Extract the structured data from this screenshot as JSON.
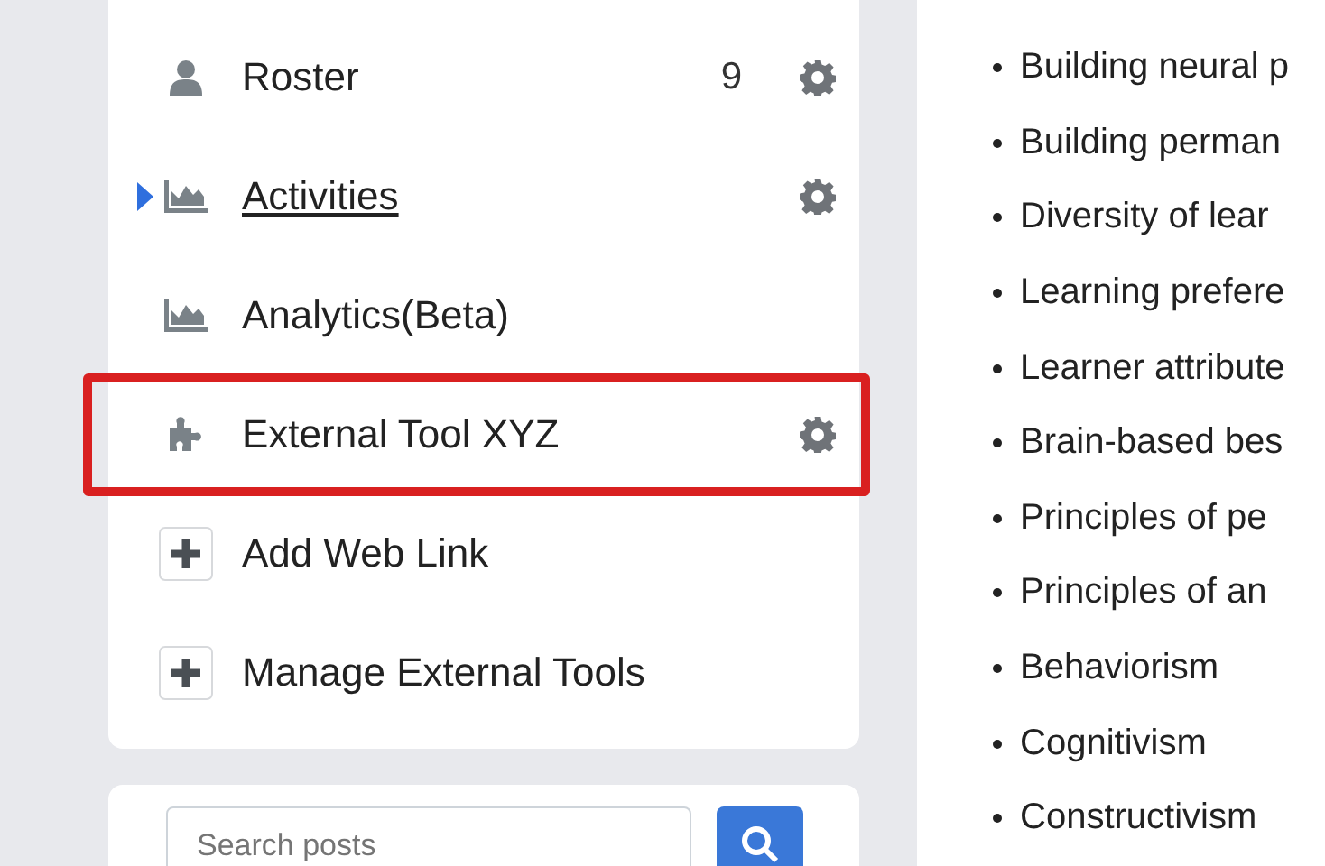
{
  "nav": {
    "items": [
      {
        "label": "Roster",
        "kind": "person",
        "count": "9",
        "selected": false,
        "highlighted": false,
        "settings": true
      },
      {
        "label": "Activities",
        "kind": "chart",
        "selected": true,
        "highlighted": false,
        "settings": true
      },
      {
        "label": "Analytics(Beta)",
        "kind": "chart",
        "selected": false,
        "highlighted": false,
        "settings": false
      },
      {
        "label": "External Tool XYZ",
        "kind": "puzzle",
        "selected": false,
        "highlighted": true,
        "settings": true
      },
      {
        "label": "Add Web Link",
        "kind": "add",
        "selected": false,
        "highlighted": false,
        "settings": false
      },
      {
        "label": "Manage External Tools",
        "kind": "add",
        "selected": false,
        "highlighted": false,
        "settings": false
      }
    ]
  },
  "search": {
    "placeholder": "Search posts"
  },
  "topics": [
    "Building neural p",
    "Building perman",
    "Diversity of lear",
    "Learning prefere",
    "Learner attribute",
    "Brain-based bes",
    "Principles of pe",
    "Principles of an",
    "Behaviorism",
    "Cognitivism",
    "Constructivism"
  ]
}
